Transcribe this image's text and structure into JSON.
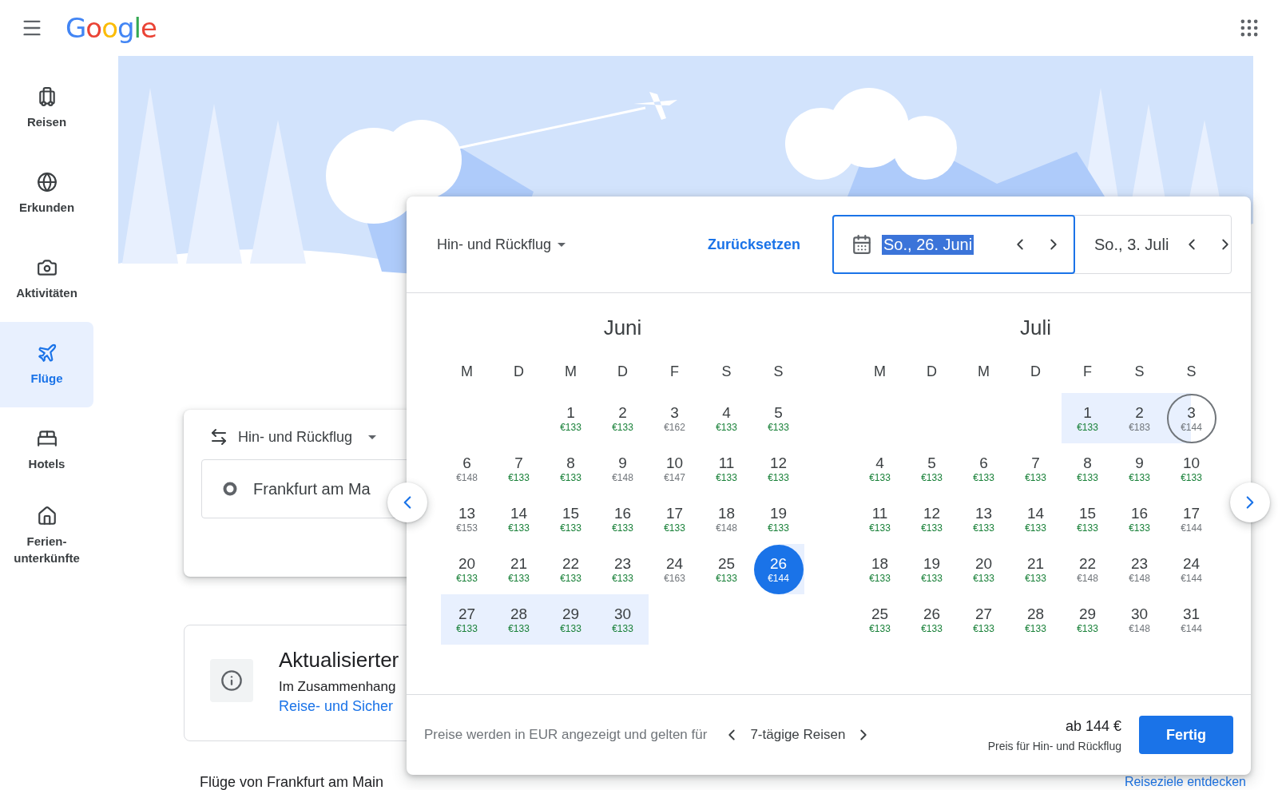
{
  "header": {
    "logo": "Google"
  },
  "sidebar": {
    "items": [
      {
        "label": "Reisen",
        "selected": false
      },
      {
        "label": "Erkunden",
        "selected": false
      },
      {
        "label": "Aktivitäten",
        "selected": false
      },
      {
        "label": "Flüge",
        "selected": true
      },
      {
        "label": "Hotels",
        "selected": false
      },
      {
        "label": "Ferien-unterkünfte",
        "selected": false
      }
    ]
  },
  "search_card": {
    "trip_type": "Hin- und Rückflug",
    "origin": "Frankfurt am Ma"
  },
  "info_card": {
    "title": "Aktualisierter",
    "text": "Im Zusammenhang",
    "link": "Reise- und Sicher"
  },
  "bottom": {
    "heading": "Flüge von Frankfurt am Main",
    "link": "Reiseziele entdecken"
  },
  "date_picker": {
    "trip_type": "Hin- und Rückflug",
    "reset": "Zurücksetzen",
    "departure": {
      "value": "So., 26. Juni",
      "focused": true
    },
    "return": {
      "value": "So., 3. Juli",
      "focused": false
    },
    "months": [
      {
        "name": "Juni",
        "weekdays": [
          "M",
          "D",
          "M",
          "D",
          "F",
          "S",
          "S"
        ],
        "days": [
          {
            "kind": "blank"
          },
          {
            "kind": "blank"
          },
          {
            "kind": "day",
            "day": "1",
            "price": "€133",
            "cheap": true,
            "selected": false,
            "in_range": false
          },
          {
            "kind": "day",
            "day": "2",
            "price": "€133",
            "cheap": true,
            "selected": false,
            "in_range": false
          },
          {
            "kind": "day",
            "day": "3",
            "price": "€162",
            "cheap": false,
            "selected": false,
            "in_range": false
          },
          {
            "kind": "day",
            "day": "4",
            "price": "€133",
            "cheap": true,
            "selected": false,
            "in_range": false
          },
          {
            "kind": "day",
            "day": "5",
            "price": "€133",
            "cheap": true,
            "selected": false,
            "in_range": false
          },
          {
            "kind": "day",
            "day": "6",
            "price": "€148",
            "cheap": false,
            "selected": false,
            "in_range": false
          },
          {
            "kind": "day",
            "day": "7",
            "price": "€133",
            "cheap": true,
            "selected": false,
            "in_range": false
          },
          {
            "kind": "day",
            "day": "8",
            "price": "€133",
            "cheap": true,
            "selected": false,
            "in_range": false
          },
          {
            "kind": "day",
            "day": "9",
            "price": "€148",
            "cheap": false,
            "selected": false,
            "in_range": false
          },
          {
            "kind": "day",
            "day": "10",
            "price": "€147",
            "cheap": false,
            "selected": false,
            "in_range": false
          },
          {
            "kind": "day",
            "day": "11",
            "price": "€133",
            "cheap": true,
            "selected": false,
            "in_range": false
          },
          {
            "kind": "day",
            "day": "12",
            "price": "€133",
            "cheap": true,
            "selected": false,
            "in_range": false
          },
          {
            "kind": "day",
            "day": "13",
            "price": "€153",
            "cheap": false,
            "selected": false,
            "in_range": false
          },
          {
            "kind": "day",
            "day": "14",
            "price": "€133",
            "cheap": true,
            "selected": false,
            "in_range": false
          },
          {
            "kind": "day",
            "day": "15",
            "price": "€133",
            "cheap": true,
            "selected": false,
            "in_range": false
          },
          {
            "kind": "day",
            "day": "16",
            "price": "€133",
            "cheap": true,
            "selected": false,
            "in_range": false
          },
          {
            "kind": "day",
            "day": "17",
            "price": "€133",
            "cheap": true,
            "selected": false,
            "in_range": false
          },
          {
            "kind": "day",
            "day": "18",
            "price": "€148",
            "cheap": false,
            "selected": false,
            "in_range": false
          },
          {
            "kind": "day",
            "day": "19",
            "price": "€133",
            "cheap": true,
            "selected": false,
            "in_range": false
          },
          {
            "kind": "day",
            "day": "20",
            "price": "€133",
            "cheap": true,
            "selected": false,
            "in_range": false
          },
          {
            "kind": "day",
            "day": "21",
            "price": "€133",
            "cheap": true,
            "selected": false,
            "in_range": false
          },
          {
            "kind": "day",
            "day": "22",
            "price": "€133",
            "cheap": true,
            "selected": false,
            "in_range": false
          },
          {
            "kind": "day",
            "day": "23",
            "price": "€133",
            "cheap": true,
            "selected": false,
            "in_range": false
          },
          {
            "kind": "day",
            "day": "24",
            "price": "€163",
            "cheap": false,
            "selected": false,
            "in_range": false
          },
          {
            "kind": "day",
            "day": "25",
            "price": "€133",
            "cheap": true,
            "selected": false,
            "in_range": false
          },
          {
            "kind": "day",
            "day": "26",
            "price": "€144",
            "cheap": false,
            "selected": true,
            "in_range": false
          },
          {
            "kind": "day",
            "day": "27",
            "price": "€133",
            "cheap": true,
            "selected": false,
            "in_range": true
          },
          {
            "kind": "day",
            "day": "28",
            "price": "€133",
            "cheap": true,
            "selected": false,
            "in_range": true
          },
          {
            "kind": "day",
            "day": "29",
            "price": "€133",
            "cheap": true,
            "selected": false,
            "in_range": true
          },
          {
            "kind": "day",
            "day": "30",
            "price": "€133",
            "cheap": true,
            "selected": false,
            "in_range": true
          }
        ]
      },
      {
        "name": "Juli",
        "weekdays": [
          "M",
          "D",
          "M",
          "D",
          "F",
          "S",
          "S"
        ],
        "days": [
          {
            "kind": "blank"
          },
          {
            "kind": "blank"
          },
          {
            "kind": "blank"
          },
          {
            "kind": "blank"
          },
          {
            "kind": "day",
            "day": "1",
            "price": "€133",
            "cheap": true,
            "selected": false,
            "in_range": true
          },
          {
            "kind": "day",
            "day": "2",
            "price": "€183",
            "cheap": false,
            "selected": false,
            "in_range": true
          },
          {
            "kind": "day",
            "day": "3",
            "price": "€144",
            "cheap": false,
            "selected": true,
            "in_range": false
          },
          {
            "kind": "day",
            "day": "4",
            "price": "€133",
            "cheap": true,
            "selected": false,
            "in_range": false
          },
          {
            "kind": "day",
            "day": "5",
            "price": "€133",
            "cheap": true,
            "selected": false,
            "in_range": false
          },
          {
            "kind": "day",
            "day": "6",
            "price": "€133",
            "cheap": true,
            "selected": false,
            "in_range": false
          },
          {
            "kind": "day",
            "day": "7",
            "price": "€133",
            "cheap": true,
            "selected": false,
            "in_range": false
          },
          {
            "kind": "day",
            "day": "8",
            "price": "€133",
            "cheap": true,
            "selected": false,
            "in_range": false
          },
          {
            "kind": "day",
            "day": "9",
            "price": "€133",
            "cheap": true,
            "selected": false,
            "in_range": false
          },
          {
            "kind": "day",
            "day": "10",
            "price": "€133",
            "cheap": true,
            "selected": false,
            "in_range": false
          },
          {
            "kind": "day",
            "day": "11",
            "price": "€133",
            "cheap": true,
            "selected": false,
            "in_range": false
          },
          {
            "kind": "day",
            "day": "12",
            "price": "€133",
            "cheap": true,
            "selected": false,
            "in_range": false
          },
          {
            "kind": "day",
            "day": "13",
            "price": "€133",
            "cheap": true,
            "selected": false,
            "in_range": false
          },
          {
            "kind": "day",
            "day": "14",
            "price": "€133",
            "cheap": true,
            "selected": false,
            "in_range": false
          },
          {
            "kind": "day",
            "day": "15",
            "price": "€133",
            "cheap": true,
            "selected": false,
            "in_range": false
          },
          {
            "kind": "day",
            "day": "16",
            "price": "€133",
            "cheap": true,
            "selected": false,
            "in_range": false
          },
          {
            "kind": "day",
            "day": "17",
            "price": "€144",
            "cheap": false,
            "selected": false,
            "in_range": false
          },
          {
            "kind": "day",
            "day": "18",
            "price": "€133",
            "cheap": true,
            "selected": false,
            "in_range": false
          },
          {
            "kind": "day",
            "day": "19",
            "price": "€133",
            "cheap": true,
            "selected": false,
            "in_range": false
          },
          {
            "kind": "day",
            "day": "20",
            "price": "€133",
            "cheap": true,
            "selected": false,
            "in_range": false
          },
          {
            "kind": "day",
            "day": "21",
            "price": "€133",
            "cheap": true,
            "selected": false,
            "in_range": false
          },
          {
            "kind": "day",
            "day": "22",
            "price": "€148",
            "cheap": false,
            "selected": false,
            "in_range": false
          },
          {
            "kind": "day",
            "day": "23",
            "price": "€148",
            "cheap": false,
            "selected": false,
            "in_range": false
          },
          {
            "kind": "day",
            "day": "24",
            "price": "€144",
            "cheap": false,
            "selected": false,
            "in_range": false
          },
          {
            "kind": "day",
            "day": "25",
            "price": "€133",
            "cheap": true,
            "selected": false,
            "in_range": false
          },
          {
            "kind": "day",
            "day": "26",
            "price": "€133",
            "cheap": true,
            "selected": false,
            "in_range": false
          },
          {
            "kind": "day",
            "day": "27",
            "price": "€133",
            "cheap": true,
            "selected": false,
            "in_range": false
          },
          {
            "kind": "day",
            "day": "28",
            "price": "€133",
            "cheap": true,
            "selected": false,
            "in_range": false
          },
          {
            "kind": "day",
            "day": "29",
            "price": "€133",
            "cheap": true,
            "selected": false,
            "in_range": false
          },
          {
            "kind": "day",
            "day": "30",
            "price": "€148",
            "cheap": false,
            "selected": false,
            "in_range": false
          },
          {
            "kind": "day",
            "day": "31",
            "price": "€144",
            "cheap": false,
            "selected": false,
            "in_range": false
          }
        ]
      }
    ],
    "footer": {
      "note": "Preise werden in EUR angezeigt und gelten für",
      "duration": "7-tägige Reisen",
      "total": "ab 144 €",
      "total_note": "Preis für Hin- und Rückflug",
      "done": "Fertig"
    }
  }
}
